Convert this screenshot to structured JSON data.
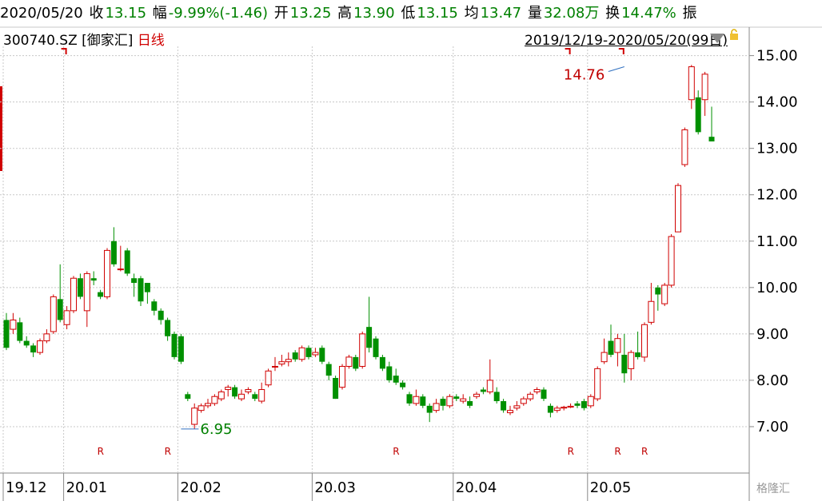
{
  "header": {
    "date": "2020/05/20",
    "close_label": "收",
    "close": "13.15",
    "change_label": "幅",
    "change": "-9.99%(-1.46)",
    "open_label": "开",
    "open": "13.25",
    "high_label": "高",
    "high": "13.90",
    "low_label": "低",
    "low": "13.15",
    "avg_label": "均",
    "avg": "13.47",
    "vol_label": "量",
    "vol": "32.08万",
    "turnover_label": "换",
    "turnover": "14.47%",
    "amp_label": "振"
  },
  "info": {
    "code": "300740.SZ [御家汇]",
    "period": "日线",
    "range": "2019/12/19-2020/05/20(99日)"
  },
  "watermark": "格隆汇",
  "colors": {
    "up": "#d00000",
    "down": "#009000",
    "grid": "#c8c8c8"
  },
  "chart_data": {
    "type": "candlestick",
    "ylim": [
      6.0,
      15.2
    ],
    "yticks": [
      "7.00",
      "8.00",
      "9.00",
      "10.00",
      "11.00",
      "12.00",
      "13.00",
      "14.00",
      "15.00"
    ],
    "xticks": [
      "19.12",
      "20.01",
      "20.02",
      "20.03",
      "20.04",
      "20.05"
    ],
    "xtick_index": [
      0,
      9,
      26,
      46,
      67,
      87
    ],
    "annotations": {
      "max": "14.76",
      "min": "6.95",
      "max_index": 92,
      "min_index": 26
    },
    "r_marks": [
      "R",
      "R",
      "R",
      "R",
      "R",
      "R"
    ],
    "r_index": [
      14,
      24,
      58,
      84,
      91,
      95
    ],
    "candles": [
      [
        9.3,
        8.7,
        9.45,
        8.65
      ],
      [
        9.1,
        9.3,
        9.45,
        9.0
      ],
      [
        9.25,
        8.85,
        9.35,
        8.8
      ],
      [
        8.85,
        8.75,
        8.95,
        8.7
      ],
      [
        8.75,
        8.6,
        8.8,
        8.5
      ],
      [
        8.6,
        8.85,
        8.9,
        8.55
      ],
      [
        8.85,
        9.0,
        9.1,
        8.8
      ],
      [
        9.05,
        9.8,
        9.85,
        9.0
      ],
      [
        9.75,
        9.3,
        10.5,
        9.25
      ],
      [
        9.2,
        9.5,
        9.6,
        9.1
      ],
      [
        9.5,
        10.2,
        10.25,
        9.45
      ],
      [
        10.2,
        9.8,
        10.3,
        9.75
      ],
      [
        9.5,
        10.3,
        10.35,
        9.15
      ],
      [
        10.2,
        10.15,
        10.35,
        10.05
      ],
      [
        9.9,
        9.8,
        9.95,
        9.75
      ],
      [
        9.8,
        10.8,
        10.85,
        9.75
      ],
      [
        11.0,
        10.5,
        11.3,
        10.45
      ],
      [
        10.4,
        10.4,
        10.9,
        10.35
      ],
      [
        10.8,
        10.3,
        10.85,
        10.25
      ],
      [
        10.2,
        10.1,
        10.3,
        9.8
      ],
      [
        10.2,
        9.7,
        10.25,
        9.6
      ],
      [
        10.1,
        9.9,
        10.1,
        9.65
      ],
      [
        9.7,
        9.5,
        9.75,
        9.4
      ],
      [
        9.5,
        9.3,
        9.55,
        9.2
      ],
      [
        9.3,
        8.95,
        9.35,
        8.85
      ],
      [
        9.0,
        8.5,
        9.05,
        8.45
      ],
      [
        8.95,
        8.4,
        9.0,
        8.35
      ],
      [
        7.7,
        7.6,
        7.75,
        7.55
      ],
      [
        7.05,
        7.4,
        7.5,
        6.95
      ],
      [
        7.35,
        7.45,
        7.5,
        7.3
      ],
      [
        7.45,
        7.5,
        7.6,
        7.4
      ],
      [
        7.5,
        7.65,
        7.7,
        7.45
      ],
      [
        7.6,
        7.75,
        7.8,
        7.55
      ],
      [
        7.8,
        7.85,
        7.9,
        7.65
      ],
      [
        7.85,
        7.65,
        7.9,
        7.6
      ],
      [
        7.6,
        7.7,
        7.8,
        7.55
      ],
      [
        7.75,
        7.8,
        7.85,
        7.7
      ],
      [
        7.7,
        7.6,
        7.75,
        7.55
      ],
      [
        7.55,
        7.8,
        7.95,
        7.5
      ],
      [
        7.9,
        8.2,
        8.25,
        7.85
      ],
      [
        8.3,
        8.3,
        8.5,
        8.2
      ],
      [
        8.35,
        8.4,
        8.55,
        8.3
      ],
      [
        8.4,
        8.45,
        8.6,
        8.3
      ],
      [
        8.6,
        8.45,
        8.65,
        8.4
      ],
      [
        8.45,
        8.7,
        8.75,
        8.4
      ],
      [
        8.7,
        8.5,
        8.75,
        8.45
      ],
      [
        8.55,
        8.6,
        8.7,
        8.5
      ],
      [
        8.7,
        8.4,
        8.75,
        8.35
      ],
      [
        8.35,
        8.1,
        8.4,
        8.0
      ],
      [
        8.05,
        7.6,
        8.1,
        7.6
      ],
      [
        7.85,
        8.3,
        8.35,
        7.8
      ],
      [
        8.3,
        8.5,
        8.55,
        8.25
      ],
      [
        8.5,
        8.25,
        8.55,
        8.2
      ],
      [
        8.3,
        9.0,
        9.05,
        8.25
      ],
      [
        9.15,
        8.7,
        9.8,
        8.6
      ],
      [
        8.9,
        8.5,
        8.95,
        8.45
      ],
      [
        8.5,
        8.25,
        8.55,
        8.2
      ],
      [
        8.3,
        8.0,
        8.4,
        7.95
      ],
      [
        8.1,
        7.95,
        8.25,
        7.9
      ],
      [
        7.95,
        7.85,
        8.0,
        7.8
      ],
      [
        7.7,
        7.5,
        7.75,
        7.45
      ],
      [
        7.5,
        7.65,
        7.8,
        7.45
      ],
      [
        7.65,
        7.45,
        7.7,
        7.4
      ],
      [
        7.45,
        7.3,
        7.5,
        7.1
      ],
      [
        7.35,
        7.5,
        7.6,
        7.3
      ],
      [
        7.6,
        7.45,
        7.65,
        7.35
      ],
      [
        7.45,
        7.65,
        7.7,
        7.4
      ],
      [
        7.65,
        7.6,
        7.7,
        7.55
      ],
      [
        7.55,
        7.6,
        7.7,
        7.5
      ],
      [
        7.55,
        7.45,
        7.65,
        7.4
      ],
      [
        7.65,
        7.7,
        7.75,
        7.6
      ],
      [
        7.8,
        7.75,
        7.85,
        7.7
      ],
      [
        7.75,
        8.0,
        8.45,
        7.7
      ],
      [
        7.75,
        7.55,
        7.85,
        7.5
      ],
      [
        7.55,
        7.35,
        7.6,
        7.3
      ],
      [
        7.3,
        7.35,
        7.45,
        7.25
      ],
      [
        7.4,
        7.45,
        7.55,
        7.35
      ],
      [
        7.5,
        7.6,
        7.65,
        7.45
      ],
      [
        7.6,
        7.7,
        7.75,
        7.55
      ],
      [
        7.75,
        7.8,
        7.85,
        7.7
      ],
      [
        7.8,
        7.6,
        7.85,
        7.55
      ],
      [
        7.45,
        7.3,
        7.5,
        7.2
      ],
      [
        7.35,
        7.4,
        7.45,
        7.3
      ],
      [
        7.4,
        7.42,
        7.45,
        7.35
      ],
      [
        7.42,
        7.44,
        7.5,
        7.4
      ],
      [
        7.5,
        7.45,
        7.55,
        7.4
      ],
      [
        7.55,
        7.4,
        7.6,
        7.35
      ],
      [
        7.45,
        7.65,
        7.7,
        7.4
      ],
      [
        7.6,
        8.25,
        8.3,
        7.55
      ],
      [
        8.4,
        8.6,
        8.9,
        8.35
      ],
      [
        8.85,
        8.55,
        9.2,
        8.5
      ],
      [
        8.6,
        8.9,
        9.0,
        8.3
      ],
      [
        8.55,
        8.15,
        9.0,
        7.95
      ],
      [
        8.25,
        8.6,
        8.65,
        8.0
      ],
      [
        8.6,
        8.5,
        9.05,
        8.45
      ],
      [
        8.5,
        9.2,
        9.25,
        8.4
      ],
      [
        9.25,
        9.7,
        10.1,
        9.2
      ],
      [
        10.0,
        9.85,
        10.05,
        9.5
      ],
      [
        9.65,
        10.05,
        10.1,
        9.6
      ],
      [
        10.05,
        11.1,
        11.15,
        10.0
      ],
      [
        11.2,
        12.2,
        12.25,
        11.2
      ],
      [
        12.65,
        13.4,
        13.45,
        12.6
      ],
      [
        14.05,
        14.76,
        14.8,
        13.85
      ],
      [
        14.1,
        13.35,
        14.25,
        13.3
      ],
      [
        14.05,
        14.6,
        14.65,
        13.7
      ],
      [
        13.25,
        13.15,
        13.9,
        13.15
      ]
    ]
  }
}
